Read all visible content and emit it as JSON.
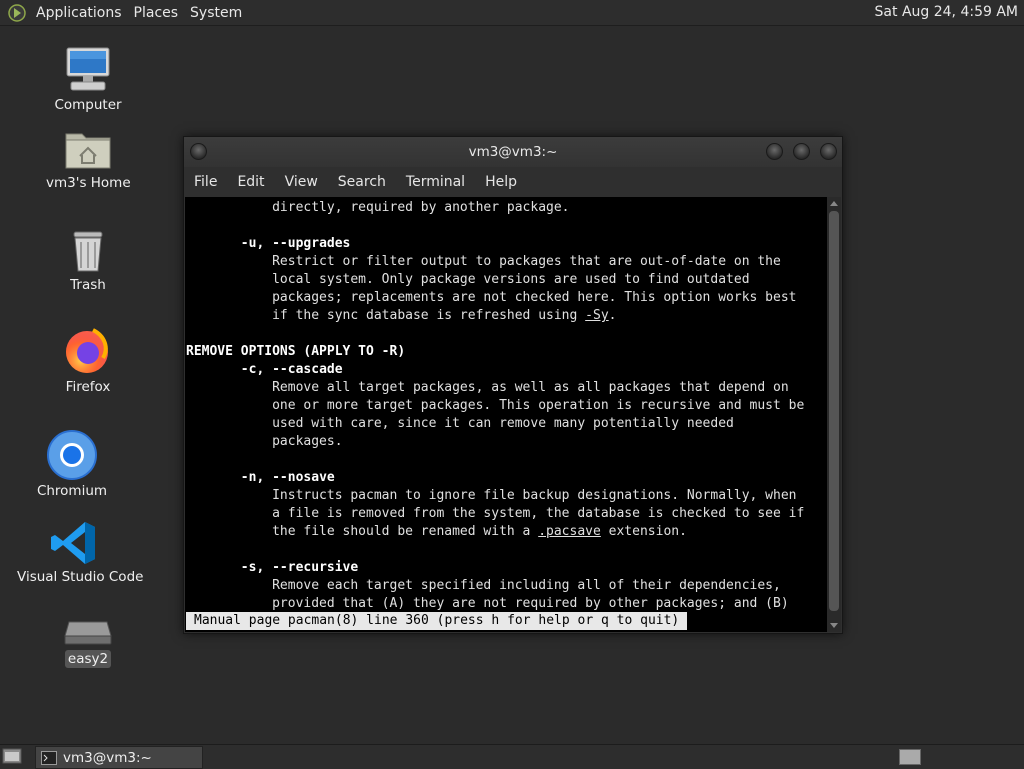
{
  "top_panel": {
    "menus": [
      "Applications",
      "Places",
      "System"
    ],
    "clock": "Sat Aug 24,  4:59 AM"
  },
  "desktop": {
    "icons": [
      {
        "label": "Computer",
        "icon": "computer-icon"
      },
      {
        "label": "vm3's Home",
        "icon": "home-folder-icon"
      },
      {
        "label": "Trash",
        "icon": "trash-icon"
      },
      {
        "label": "Firefox",
        "icon": "firefox-icon"
      },
      {
        "label": "Chromium",
        "icon": "chromium-icon"
      },
      {
        "label": "Visual Studio Code",
        "icon": "vscode-icon"
      },
      {
        "label": "easy2",
        "icon": "drive-icon"
      }
    ]
  },
  "terminal": {
    "title": "vm3@vm3:~",
    "menu": [
      "File",
      "Edit",
      "View",
      "Search",
      "Terminal",
      "Help"
    ],
    "lines": [
      {
        "parts": [
          {
            "t": "           directly, required by another package."
          }
        ]
      },
      {
        "parts": [
          {
            "t": ""
          }
        ]
      },
      {
        "parts": [
          {
            "t": "       "
          },
          {
            "t": "-u, --upgrades",
            "s": "b"
          }
        ]
      },
      {
        "parts": [
          {
            "t": "           Restrict or filter output to packages that are out-of-date on the"
          }
        ]
      },
      {
        "parts": [
          {
            "t": "           local system. Only package versions are used to find outdated"
          }
        ]
      },
      {
        "parts": [
          {
            "t": "           packages; replacements are not checked here. This option works best"
          }
        ]
      },
      {
        "parts": [
          {
            "t": "           if the sync database is refreshed using "
          },
          {
            "t": "-Sy",
            "s": "u"
          },
          {
            "t": "."
          }
        ]
      },
      {
        "parts": [
          {
            "t": ""
          }
        ]
      },
      {
        "parts": [
          {
            "t": "REMOVE OPTIONS (APPLY TO -R)",
            "s": "b"
          }
        ]
      },
      {
        "parts": [
          {
            "t": "       "
          },
          {
            "t": "-c, --cascade",
            "s": "b"
          }
        ]
      },
      {
        "parts": [
          {
            "t": "           Remove all target packages, as well as all packages that depend on"
          }
        ]
      },
      {
        "parts": [
          {
            "t": "           one or more target packages. This operation is recursive and must be"
          }
        ]
      },
      {
        "parts": [
          {
            "t": "           used with care, since it can remove many potentially needed"
          }
        ]
      },
      {
        "parts": [
          {
            "t": "           packages."
          }
        ]
      },
      {
        "parts": [
          {
            "t": ""
          }
        ]
      },
      {
        "parts": [
          {
            "t": "       "
          },
          {
            "t": "-n, --nosave",
            "s": "b"
          }
        ]
      },
      {
        "parts": [
          {
            "t": "           Instructs pacman to ignore file backup designations. Normally, when"
          }
        ]
      },
      {
        "parts": [
          {
            "t": "           a file is removed from the system, the database is checked to see if"
          }
        ]
      },
      {
        "parts": [
          {
            "t": "           the file should be renamed with a "
          },
          {
            "t": ".pacsave",
            "s": "u"
          },
          {
            "t": " extension."
          }
        ]
      },
      {
        "parts": [
          {
            "t": ""
          }
        ]
      },
      {
        "parts": [
          {
            "t": "       "
          },
          {
            "t": "-s, --recursive",
            "s": "b"
          }
        ]
      },
      {
        "parts": [
          {
            "t": "           Remove each target specified including all of their dependencies,"
          }
        ]
      },
      {
        "parts": [
          {
            "t": "           provided that (A) they are not required by other packages; and (B)"
          }
        ]
      }
    ],
    "status": "Manual page pacman(8) line 360 (press h for help or q to quit)"
  },
  "bottom_panel": {
    "task_label": "vm3@vm3:~"
  },
  "colors": {
    "desktop_bg": "#2b2b2b",
    "panel_bg": "#2d2d2d",
    "terminal_bg": "#000000",
    "terminal_fg": "#e0e0e0"
  }
}
